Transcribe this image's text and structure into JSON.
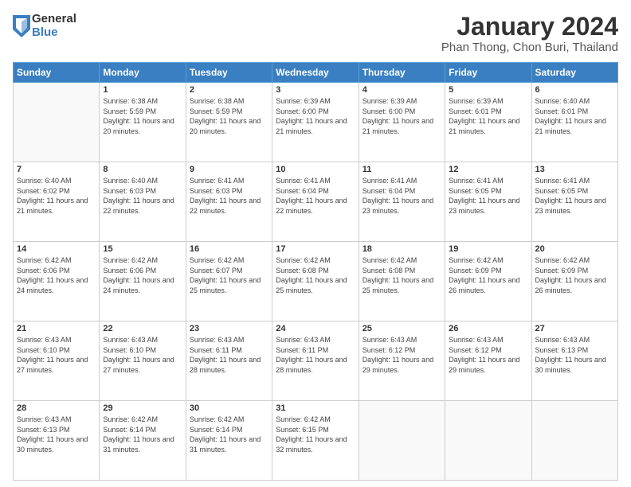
{
  "logo": {
    "general": "General",
    "blue": "Blue"
  },
  "title": "January 2024",
  "subtitle": "Phan Thong, Chon Buri, Thailand",
  "days_of_week": [
    "Sunday",
    "Monday",
    "Tuesday",
    "Wednesday",
    "Thursday",
    "Friday",
    "Saturday"
  ],
  "weeks": [
    [
      {
        "day": "",
        "sunrise": "",
        "sunset": "",
        "daylight": ""
      },
      {
        "day": "1",
        "sunrise": "Sunrise: 6:38 AM",
        "sunset": "Sunset: 5:59 PM",
        "daylight": "Daylight: 11 hours and 20 minutes."
      },
      {
        "day": "2",
        "sunrise": "Sunrise: 6:38 AM",
        "sunset": "Sunset: 5:59 PM",
        "daylight": "Daylight: 11 hours and 20 minutes."
      },
      {
        "day": "3",
        "sunrise": "Sunrise: 6:39 AM",
        "sunset": "Sunset: 6:00 PM",
        "daylight": "Daylight: 11 hours and 21 minutes."
      },
      {
        "day": "4",
        "sunrise": "Sunrise: 6:39 AM",
        "sunset": "Sunset: 6:00 PM",
        "daylight": "Daylight: 11 hours and 21 minutes."
      },
      {
        "day": "5",
        "sunrise": "Sunrise: 6:39 AM",
        "sunset": "Sunset: 6:01 PM",
        "daylight": "Daylight: 11 hours and 21 minutes."
      },
      {
        "day": "6",
        "sunrise": "Sunrise: 6:40 AM",
        "sunset": "Sunset: 6:01 PM",
        "daylight": "Daylight: 11 hours and 21 minutes."
      }
    ],
    [
      {
        "day": "7",
        "sunrise": "Sunrise: 6:40 AM",
        "sunset": "Sunset: 6:02 PM",
        "daylight": "Daylight: 11 hours and 21 minutes."
      },
      {
        "day": "8",
        "sunrise": "Sunrise: 6:40 AM",
        "sunset": "Sunset: 6:03 PM",
        "daylight": "Daylight: 11 hours and 22 minutes."
      },
      {
        "day": "9",
        "sunrise": "Sunrise: 6:41 AM",
        "sunset": "Sunset: 6:03 PM",
        "daylight": "Daylight: 11 hours and 22 minutes."
      },
      {
        "day": "10",
        "sunrise": "Sunrise: 6:41 AM",
        "sunset": "Sunset: 6:04 PM",
        "daylight": "Daylight: 11 hours and 22 minutes."
      },
      {
        "day": "11",
        "sunrise": "Sunrise: 6:41 AM",
        "sunset": "Sunset: 6:04 PM",
        "daylight": "Daylight: 11 hours and 23 minutes."
      },
      {
        "day": "12",
        "sunrise": "Sunrise: 6:41 AM",
        "sunset": "Sunset: 6:05 PM",
        "daylight": "Daylight: 11 hours and 23 minutes."
      },
      {
        "day": "13",
        "sunrise": "Sunrise: 6:41 AM",
        "sunset": "Sunset: 6:05 PM",
        "daylight": "Daylight: 11 hours and 23 minutes."
      }
    ],
    [
      {
        "day": "14",
        "sunrise": "Sunrise: 6:42 AM",
        "sunset": "Sunset: 6:06 PM",
        "daylight": "Daylight: 11 hours and 24 minutes."
      },
      {
        "day": "15",
        "sunrise": "Sunrise: 6:42 AM",
        "sunset": "Sunset: 6:06 PM",
        "daylight": "Daylight: 11 hours and 24 minutes."
      },
      {
        "day": "16",
        "sunrise": "Sunrise: 6:42 AM",
        "sunset": "Sunset: 6:07 PM",
        "daylight": "Daylight: 11 hours and 25 minutes."
      },
      {
        "day": "17",
        "sunrise": "Sunrise: 6:42 AM",
        "sunset": "Sunset: 6:08 PM",
        "daylight": "Daylight: 11 hours and 25 minutes."
      },
      {
        "day": "18",
        "sunrise": "Sunrise: 6:42 AM",
        "sunset": "Sunset: 6:08 PM",
        "daylight": "Daylight: 11 hours and 25 minutes."
      },
      {
        "day": "19",
        "sunrise": "Sunrise: 6:42 AM",
        "sunset": "Sunset: 6:09 PM",
        "daylight": "Daylight: 11 hours and 26 minutes."
      },
      {
        "day": "20",
        "sunrise": "Sunrise: 6:42 AM",
        "sunset": "Sunset: 6:09 PM",
        "daylight": "Daylight: 11 hours and 26 minutes."
      }
    ],
    [
      {
        "day": "21",
        "sunrise": "Sunrise: 6:43 AM",
        "sunset": "Sunset: 6:10 PM",
        "daylight": "Daylight: 11 hours and 27 minutes."
      },
      {
        "day": "22",
        "sunrise": "Sunrise: 6:43 AM",
        "sunset": "Sunset: 6:10 PM",
        "daylight": "Daylight: 11 hours and 27 minutes."
      },
      {
        "day": "23",
        "sunrise": "Sunrise: 6:43 AM",
        "sunset": "Sunset: 6:11 PM",
        "daylight": "Daylight: 11 hours and 28 minutes."
      },
      {
        "day": "24",
        "sunrise": "Sunrise: 6:43 AM",
        "sunset": "Sunset: 6:11 PM",
        "daylight": "Daylight: 11 hours and 28 minutes."
      },
      {
        "day": "25",
        "sunrise": "Sunrise: 6:43 AM",
        "sunset": "Sunset: 6:12 PM",
        "daylight": "Daylight: 11 hours and 29 minutes."
      },
      {
        "day": "26",
        "sunrise": "Sunrise: 6:43 AM",
        "sunset": "Sunset: 6:12 PM",
        "daylight": "Daylight: 11 hours and 29 minutes."
      },
      {
        "day": "27",
        "sunrise": "Sunrise: 6:43 AM",
        "sunset": "Sunset: 6:13 PM",
        "daylight": "Daylight: 11 hours and 30 minutes."
      }
    ],
    [
      {
        "day": "28",
        "sunrise": "Sunrise: 6:43 AM",
        "sunset": "Sunset: 6:13 PM",
        "daylight": "Daylight: 11 hours and 30 minutes."
      },
      {
        "day": "29",
        "sunrise": "Sunrise: 6:42 AM",
        "sunset": "Sunset: 6:14 PM",
        "daylight": "Daylight: 11 hours and 31 minutes."
      },
      {
        "day": "30",
        "sunrise": "Sunrise: 6:42 AM",
        "sunset": "Sunset: 6:14 PM",
        "daylight": "Daylight: 11 hours and 31 minutes."
      },
      {
        "day": "31",
        "sunrise": "Sunrise: 6:42 AM",
        "sunset": "Sunset: 6:15 PM",
        "daylight": "Daylight: 11 hours and 32 minutes."
      },
      {
        "day": "",
        "sunrise": "",
        "sunset": "",
        "daylight": ""
      },
      {
        "day": "",
        "sunrise": "",
        "sunset": "",
        "daylight": ""
      },
      {
        "day": "",
        "sunrise": "",
        "sunset": "",
        "daylight": ""
      }
    ]
  ]
}
